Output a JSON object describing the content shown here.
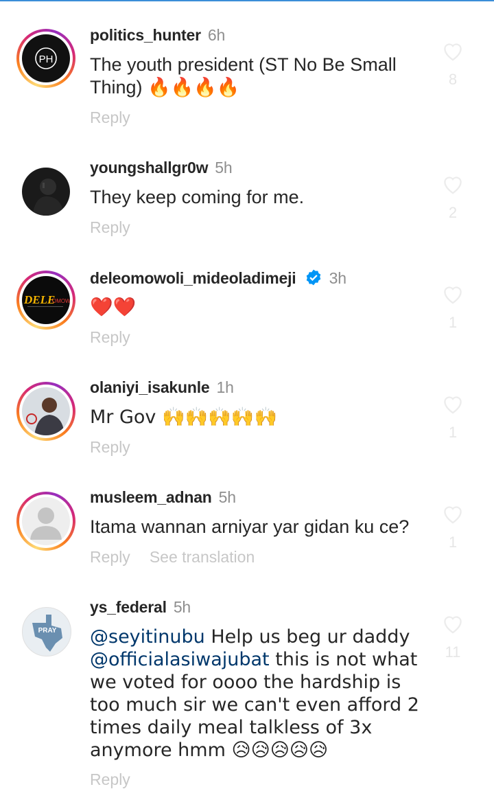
{
  "comments": [
    {
      "username": "politics_hunter",
      "time": "6h",
      "text": "The youth president (ST No Be Small Thing) 🔥🔥🔥🔥",
      "reply": "Reply",
      "likes": "8",
      "avatar_text": "PH"
    },
    {
      "username": "youngshallgr0w",
      "time": "5h",
      "text": "They keep coming for me.",
      "reply": "Reply",
      "likes": "2"
    },
    {
      "username": "deleomowoli_mideoladimeji",
      "time": "3h",
      "text": "❤️❤️",
      "reply": "Reply",
      "likes": "1",
      "avatar_text": "DELE",
      "avatar_text2": "OMOWO"
    },
    {
      "username": "olaniyi_isakunle",
      "time": "1h",
      "text": "Mr Gov 🙌🙌🙌🙌🙌",
      "reply": "Reply",
      "likes": "1"
    },
    {
      "username": "musleem_adnan",
      "time": "5h",
      "text": "Itama wannan arniyar yar gidan ku ce?",
      "reply": "Reply",
      "see_translation": "See translation",
      "likes": "1"
    },
    {
      "username": "ys_federal",
      "time": "5h",
      "mention1": "@seyitinubu",
      "text_part1": " Help us beg ur daddy ",
      "mention2": "@officialasiwajubat",
      "text_part2": " this is not what we voted for oooo the hardship is too much sir we can't even afford 2 times daily meal talkless of 3x anymore hmm 😥😥😥😥😥",
      "reply": "Reply",
      "likes": "11",
      "avatar_text": "PRAY"
    }
  ],
  "colors": {
    "accent_line": "#3b8ed8",
    "mention": "#00376b",
    "verified": "#0095f6"
  }
}
